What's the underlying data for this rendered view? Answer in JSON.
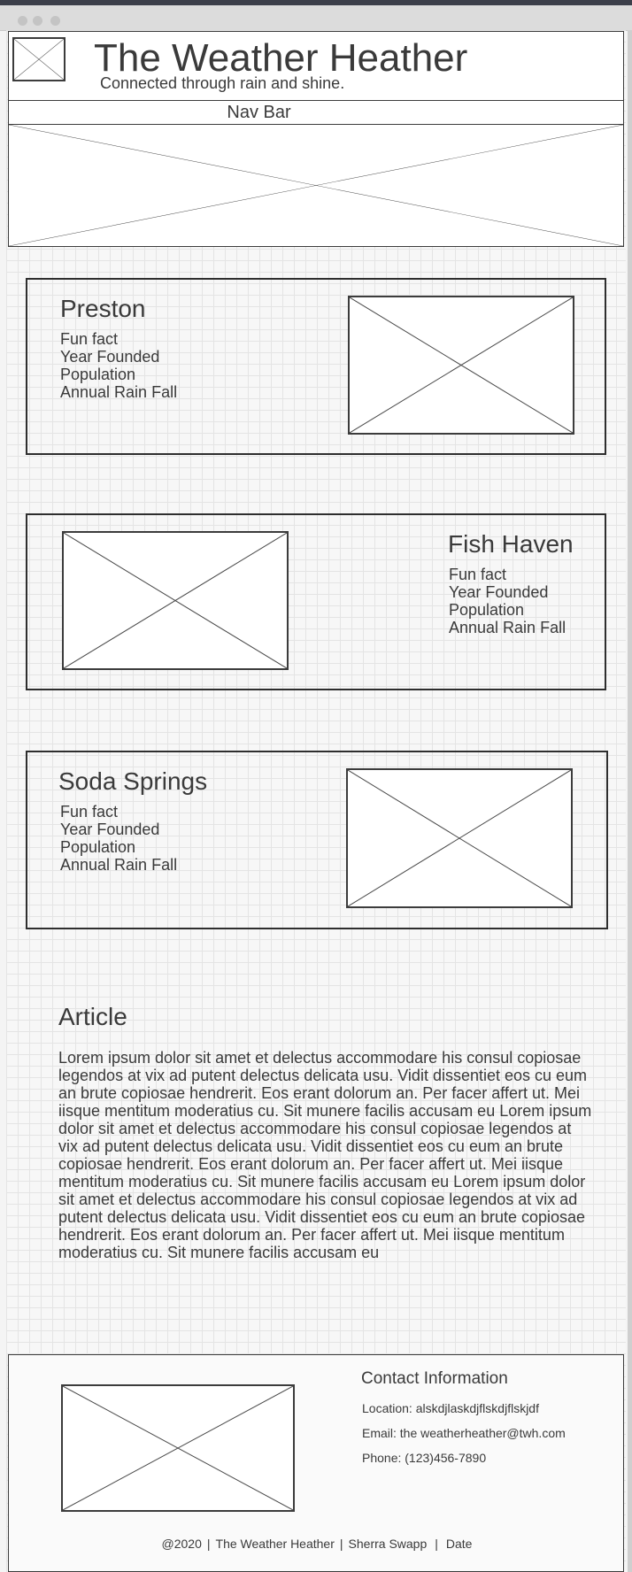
{
  "header": {
    "title": "The Weather Heather",
    "tagline": "Connected through rain and shine."
  },
  "nav": {
    "label": "Nav Bar"
  },
  "cities": [
    {
      "name": "Preston",
      "facts": [
        "Fun fact",
        "Year Founded",
        "Population",
        "Annual Rain Fall"
      ]
    },
    {
      "name": "Fish Haven",
      "facts": [
        "Fun fact",
        "Year Founded",
        "Population",
        "Annual Rain Fall"
      ]
    },
    {
      "name": "Soda Springs",
      "facts": [
        "Fun fact",
        "Year Founded",
        "Population",
        "Annual Rain Fall"
      ]
    }
  ],
  "article": {
    "title": "Article",
    "body": "Lorem ipsum dolor sit amet et delectus accommodare his consul copiosae legendos at vix ad putent delectus delicata usu. Vidit dissentiet eos cu eum an brute copiosae hendrerit. Eos erant dolorum an. Per facer affert ut. Mei iisque mentitum moderatius cu. Sit munere facilis accusam eu Lorem ipsum dolor sit amet et delectus accommodare his consul copiosae legendos at vix ad putent delectus delicata usu. Vidit dissentiet eos cu eum an brute copiosae hendrerit. Eos erant dolorum an. Per facer affert ut. Mei iisque mentitum moderatius cu. Sit munere facilis accusam eu Lorem ipsum dolor sit amet et delectus accommodare his consul copiosae legendos at vix ad putent delectus delicata usu. Vidit dissentiet eos cu eum an brute copiosae hendrerit. Eos erant dolorum an. Per facer affert ut. Mei iisque mentitum moderatius cu. Sit munere facilis accusam eu"
  },
  "footer": {
    "contact_title": "Contact Information",
    "location": "Location: alskdjlaskdjflskdjflskjdf",
    "email": "Email: the weatherheather@twh.com",
    "phone": "Phone: (123)456-7890",
    "copyright_parts": [
      "@2020",
      "The Weather Heather",
      "Sherra Swapp",
      "Date"
    ],
    "separator": "|"
  },
  "colors": {
    "text": "#3a3a3a",
    "border": "#3c3c3c",
    "grid": "#e4e4e4"
  }
}
